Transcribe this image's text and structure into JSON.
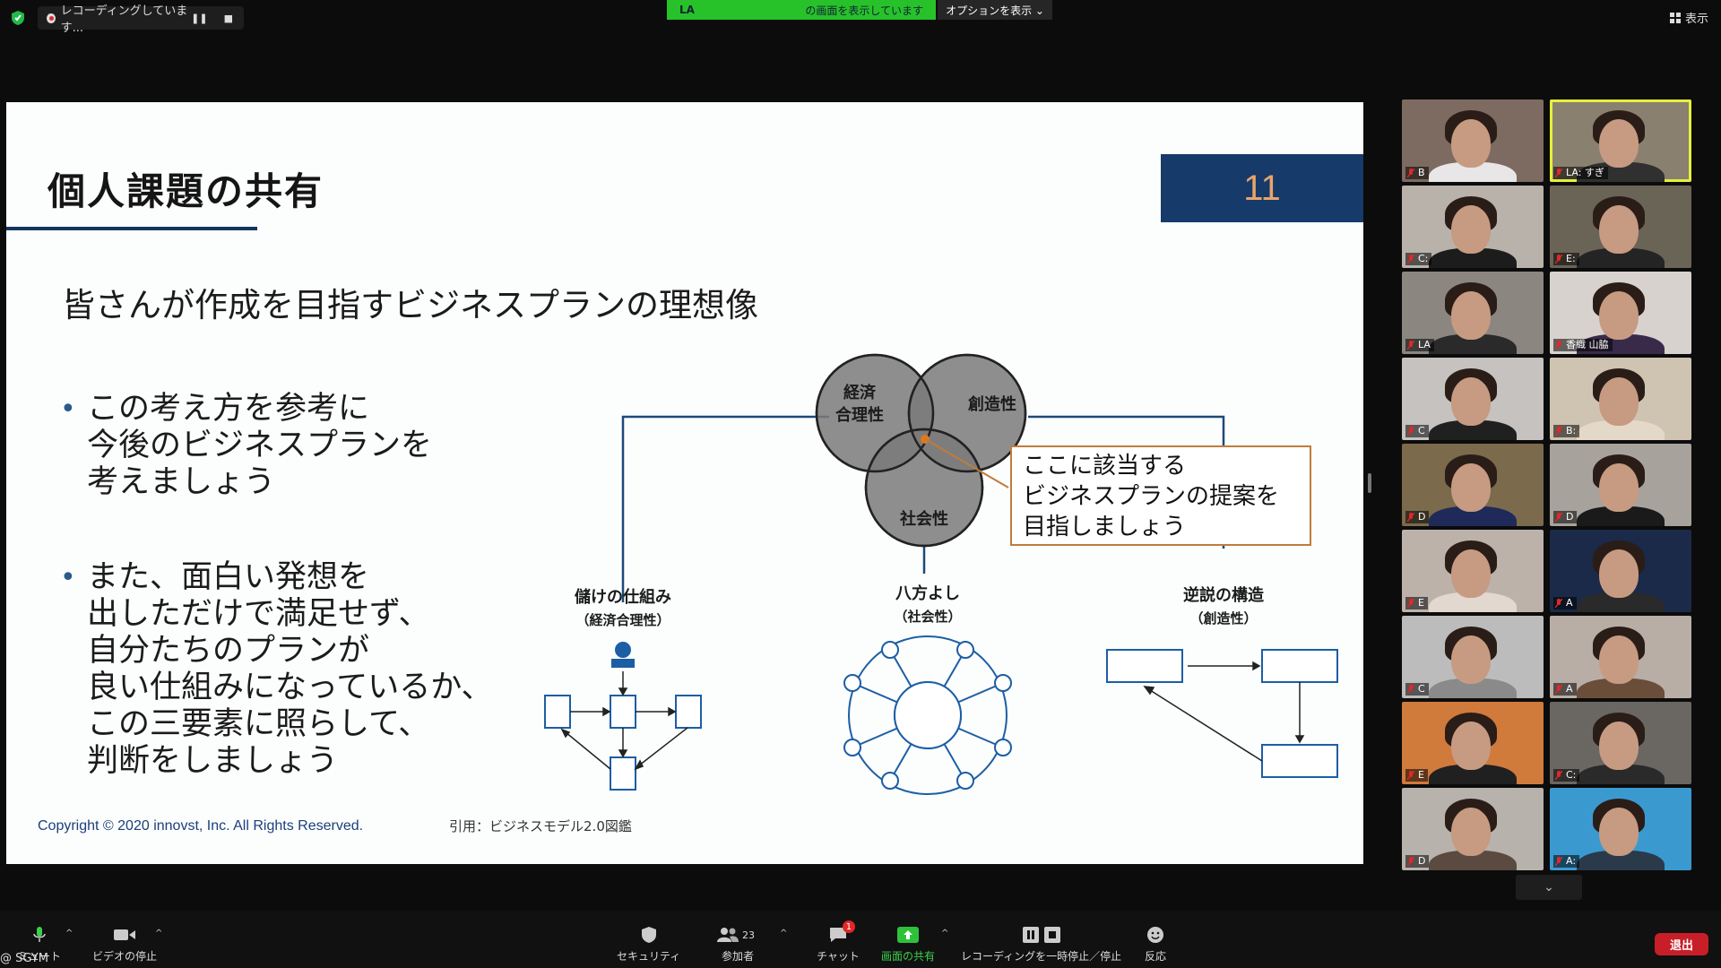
{
  "top_bar": {
    "recording_text": "レコーディングしています...",
    "pause_glyph": "❚❚",
    "stop_glyph": "■",
    "sharer": "LA",
    "share_status": "の画面を表示しています",
    "options_label": "オプションを表示 ⌄",
    "view_label": "表示"
  },
  "slide": {
    "title": "個人課題の共有",
    "page_number": "11",
    "subtitle": "皆さんが作成を目指すビジネスプランの理想像",
    "bullets": [
      [
        "この考え方を参考に",
        "今後のビジネスプランを",
        "考えましょう"
      ],
      [
        "また、面白い発想を",
        "出しただけで満足せず、",
        "自分たちのプランが",
        "良い仕組みになっているか、",
        "この三要素に照らして、",
        "判断をしましょう"
      ]
    ],
    "bullet_mark": "•",
    "circles": {
      "economic_line1": "経済",
      "economic_line2": "合理性",
      "creative": "創造性",
      "social": "社会性"
    },
    "callout": [
      "ここに該当する",
      "ビジネスプランの提案を",
      "目指しましょう"
    ],
    "sections": {
      "left_title": "儲けの仕組み",
      "left_sub": "（経済合理性）",
      "middle_title": "八方よし",
      "middle_sub": "（社会性）",
      "right_title": "逆説の構造",
      "right_sub": "（創造性）"
    },
    "copyright": "Copyright © 2020 innovst, Inc.  All Rights Reserved.",
    "citation": "引用：ビジネスモデル2.0図鑑"
  },
  "gallery": [
    {
      "name": "B",
      "bg": "#7d6a60",
      "shirt": "#e8e6e6"
    },
    {
      "name": "LA: すぎ",
      "bg": "#8a8070",
      "shirt": "#303030"
    },
    {
      "name": "C:",
      "bg": "#b9b2aa",
      "shirt": "#1c1c1c"
    },
    {
      "name": "E:",
      "bg": "#6a6456",
      "shirt": "#242424"
    },
    {
      "name": "LA",
      "bg": "#8b8680",
      "shirt": "#2a2a2a"
    },
    {
      "name": "香織 山脇",
      "bg": "#d8d2ce",
      "shirt": "#3a2a4a"
    },
    {
      "name": "C",
      "bg": "#c5c2c0",
      "shirt": "#202020"
    },
    {
      "name": "B:",
      "bg": "#cfc4b2",
      "shirt": "#e4d8c8"
    },
    {
      "name": "D",
      "bg": "#7b6a4c",
      "shirt": "#1f2a5a"
    },
    {
      "name": "D",
      "bg": "#a8a29c",
      "shirt": "#1a1a1a"
    },
    {
      "name": "E",
      "bg": "#bdb2aa",
      "shirt": "#e2d8d0"
    },
    {
      "name": "A",
      "bg": "#1a2a48",
      "shirt": "#2a2a2a"
    },
    {
      "name": "C",
      "bg": "#bcbcbc",
      "shirt": "#8a8a8a"
    },
    {
      "name": "A",
      "bg": "#b8aea6",
      "shirt": "#6a4e3a"
    },
    {
      "name": "E",
      "bg": "#d07a3c",
      "shirt": "#202020"
    },
    {
      "name": "C:",
      "bg": "#6a6662",
      "shirt": "#2a2a2a"
    },
    {
      "name": "D",
      "bg": "#b8b2ac",
      "shirt": "#5a4a40"
    },
    {
      "name": "A:",
      "bg": "#3a9ad0",
      "shirt": "#2a3a4a"
    }
  ],
  "toolbar": {
    "mute_label": "ミュート",
    "video_label": "ビデオの停止",
    "security_label": "セキュリティ",
    "participants_label": "参加者",
    "participants_count": "23",
    "chat_label": "チャット",
    "chat_badge": "1",
    "share_label": "画面の共有",
    "record_label": "レコーディングを一時停止／停止",
    "reactions_label": "反応",
    "leave_label": "退出",
    "user_tag": "@ SGYM"
  },
  "colors": {
    "accent_navy": "#163a6a",
    "page_number": "#e8a56a",
    "share_green": "#27c22a",
    "leave_red": "#c81e28",
    "callout_border": "#c07c3c"
  }
}
